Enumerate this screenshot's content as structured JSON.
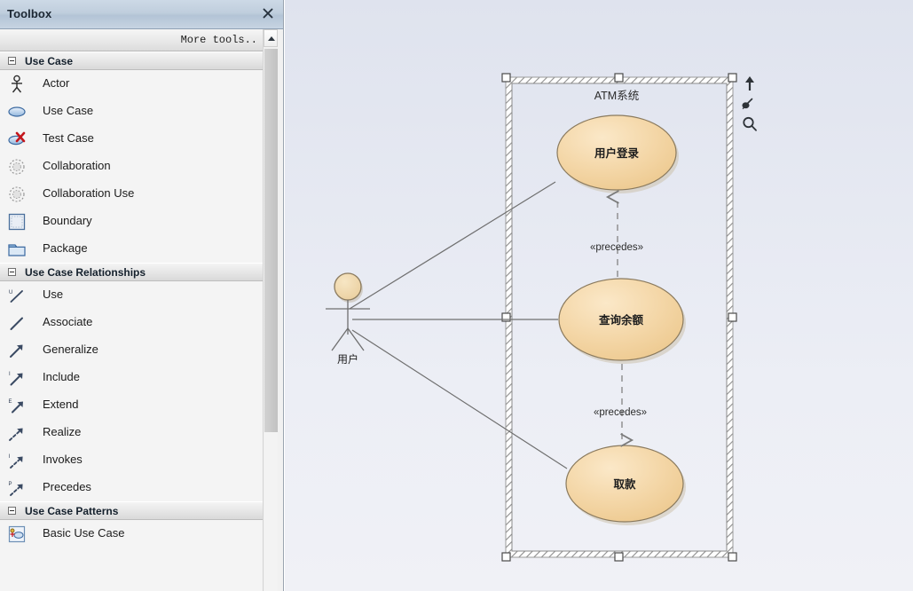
{
  "toolbox": {
    "title": "Toolbox",
    "close_icon": "close-icon",
    "more_tools_label": "More tools..",
    "scroll_up_icon": "chevron-up-icon",
    "groups": [
      {
        "name": "Use Case",
        "collapse_icon": "minus-box-icon",
        "items": [
          {
            "label": "Actor",
            "icon": "actor-icon"
          },
          {
            "label": "Use Case",
            "icon": "use-case-ellipse-icon"
          },
          {
            "label": "Test Case",
            "icon": "test-case-icon"
          },
          {
            "label": "Collaboration",
            "icon": "collaboration-icon"
          },
          {
            "label": "Collaboration Use",
            "icon": "collaboration-use-icon"
          },
          {
            "label": "Boundary",
            "icon": "boundary-icon"
          },
          {
            "label": "Package",
            "icon": "package-icon"
          }
        ]
      },
      {
        "name": "Use Case Relationships",
        "collapse_icon": "minus-box-icon",
        "items": [
          {
            "label": "Use",
            "icon": "use-link-icon"
          },
          {
            "label": "Associate",
            "icon": "associate-link-icon"
          },
          {
            "label": "Generalize",
            "icon": "generalize-link-icon"
          },
          {
            "label": "Include",
            "icon": "include-link-icon"
          },
          {
            "label": "Extend",
            "icon": "extend-link-icon"
          },
          {
            "label": "Realize",
            "icon": "realize-link-icon"
          },
          {
            "label": "Invokes",
            "icon": "invokes-link-icon"
          },
          {
            "label": "Precedes",
            "icon": "precedes-link-icon"
          }
        ]
      },
      {
        "name": "Use Case Patterns",
        "collapse_icon": "minus-box-icon",
        "items": [
          {
            "label": "Basic Use Case",
            "icon": "basic-use-case-pattern-icon"
          }
        ]
      }
    ]
  },
  "diagram": {
    "boundary": {
      "label": "ATM系统",
      "selected": true
    },
    "actor": {
      "label": "用户"
    },
    "use_cases": [
      {
        "label": "用户登录"
      },
      {
        "label": "查询余额"
      },
      {
        "label": "取款"
      }
    ],
    "relationships": [
      {
        "stereotype": "«precedes»",
        "from": "查询余额",
        "to": "用户登录"
      },
      {
        "stereotype": "«precedes»",
        "from": "查询余额",
        "to": "取款"
      }
    ],
    "mini_tools": [
      {
        "icon": "arrow-up-icon"
      },
      {
        "icon": "pointer-select-icon"
      },
      {
        "icon": "magnifier-zoom-icon"
      }
    ],
    "colors": {
      "use_case_fill": "#f4d6a6",
      "use_case_stroke": "#8a7a5e",
      "actor_head_fill": "#f0d9ae",
      "line": "#6f6f6f",
      "canvas_bg": "#e6e9f2"
    }
  }
}
